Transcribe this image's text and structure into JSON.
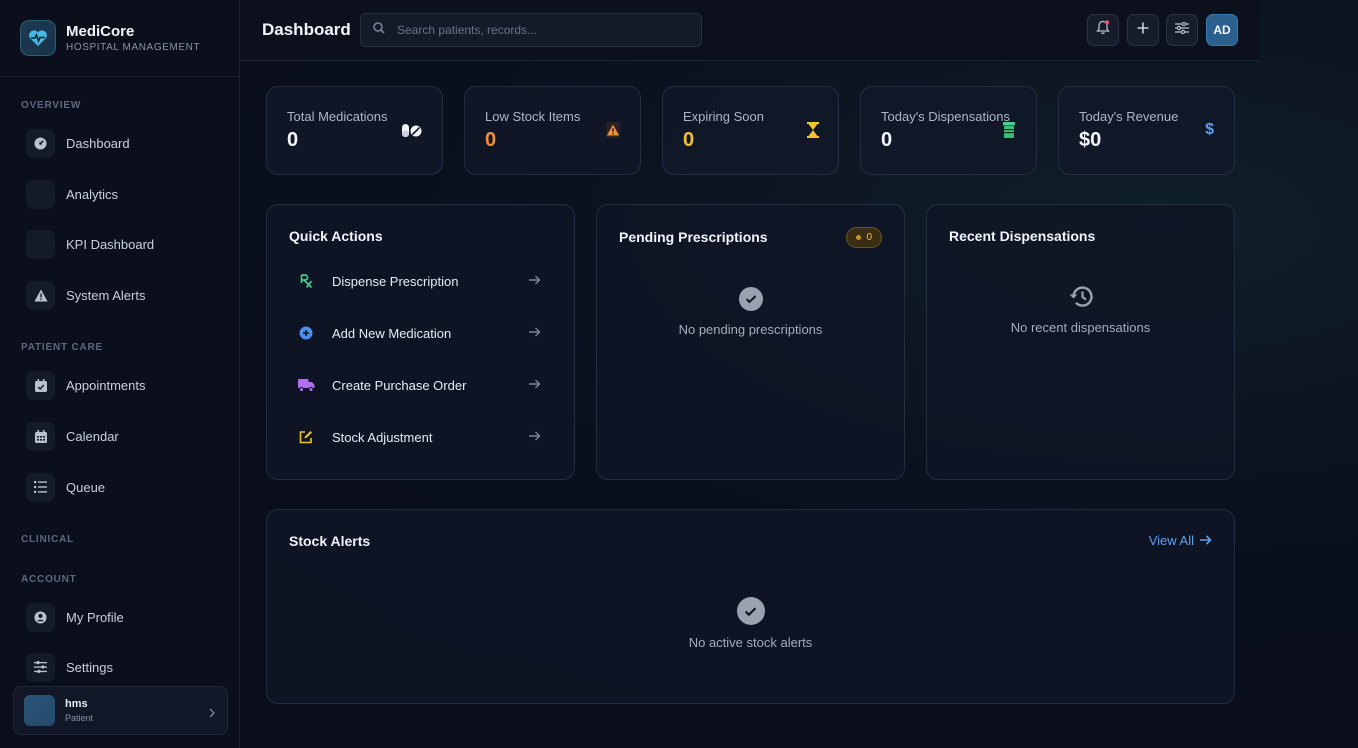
{
  "brand": {
    "name": "MediCore",
    "subtitle": "HOSPITAL MANAGEMENT"
  },
  "sidebar": {
    "sections": {
      "overview": "OVERVIEW",
      "patient_care": "PATIENT CARE",
      "clinical": "CLINICAL",
      "account": "ACCOUNT"
    },
    "items": [
      {
        "label": "Dashboard",
        "icon": "gauge-icon"
      },
      {
        "label": "Analytics",
        "icon": "chart-icon"
      },
      {
        "label": "KPI Dashboard",
        "icon": "kpi-icon"
      },
      {
        "label": "System Alerts",
        "icon": "warning-icon"
      },
      {
        "label": "Appointments",
        "icon": "calendar-check-icon"
      },
      {
        "label": "Calendar",
        "icon": "calendar-icon"
      },
      {
        "label": "Queue",
        "icon": "list-icon"
      },
      {
        "label": "My Profile",
        "icon": "user-circle-icon"
      },
      {
        "label": "Settings",
        "icon": "sliders-icon"
      }
    ],
    "user": {
      "name": "hms",
      "role": "Patient"
    }
  },
  "header": {
    "title": "Dashboard",
    "search_placeholder": "Search patients, records...",
    "avatar_initials": "AD"
  },
  "stats": [
    {
      "label": "Total Medications",
      "value": "0",
      "color": "#f2f5fa",
      "icon": "pills-icon"
    },
    {
      "label": "Low Stock Items",
      "value": "0",
      "color": "#f0903a",
      "icon": "warning-icon"
    },
    {
      "label": "Expiring Soon",
      "value": "0",
      "color": "#f2c232",
      "icon": "hourglass-icon"
    },
    {
      "label": "Today's Dispensations",
      "value": "0",
      "color": "#f2f5fa",
      "icon": "prescription-bottle-icon"
    },
    {
      "label": "Today's Revenue",
      "value": "$0",
      "color": "#f2f5fa",
      "icon": "dollar-icon"
    }
  ],
  "quick_actions": {
    "title": "Quick Actions",
    "items": [
      {
        "label": "Dispense Prescription",
        "icon": "rx-icon"
      },
      {
        "label": "Add New Medication",
        "icon": "plus-circle-icon"
      },
      {
        "label": "Create Purchase Order",
        "icon": "truck-icon"
      },
      {
        "label": "Stock Adjustment",
        "icon": "edit-icon"
      }
    ]
  },
  "pending": {
    "title": "Pending Prescriptions",
    "count": "0",
    "empty": "No pending prescriptions"
  },
  "recent": {
    "title": "Recent Dispensations",
    "empty": "No recent dispensations"
  },
  "stock_alerts": {
    "title": "Stock Alerts",
    "view_all": "View All",
    "empty": "No active stock alerts"
  }
}
